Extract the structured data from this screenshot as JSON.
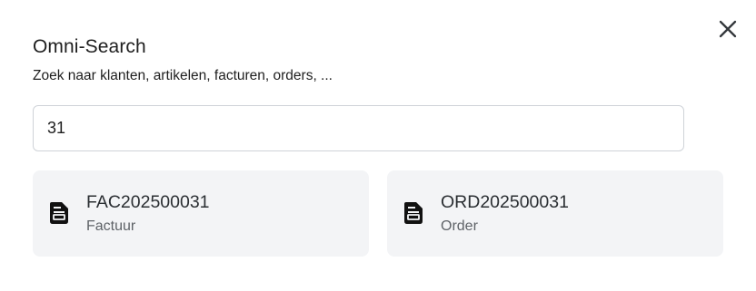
{
  "dialog": {
    "title": "Omni-Search",
    "subtitle": "Zoek naar klanten, artikelen, facturen, orders, ...",
    "close_icon": "close-icon"
  },
  "search": {
    "value": "31"
  },
  "results": [
    {
      "title": "FAC202500031",
      "type": "Factuur",
      "icon": "document-icon"
    },
    {
      "title": "ORD202500031",
      "type": "Order",
      "icon": "document-icon"
    }
  ]
}
